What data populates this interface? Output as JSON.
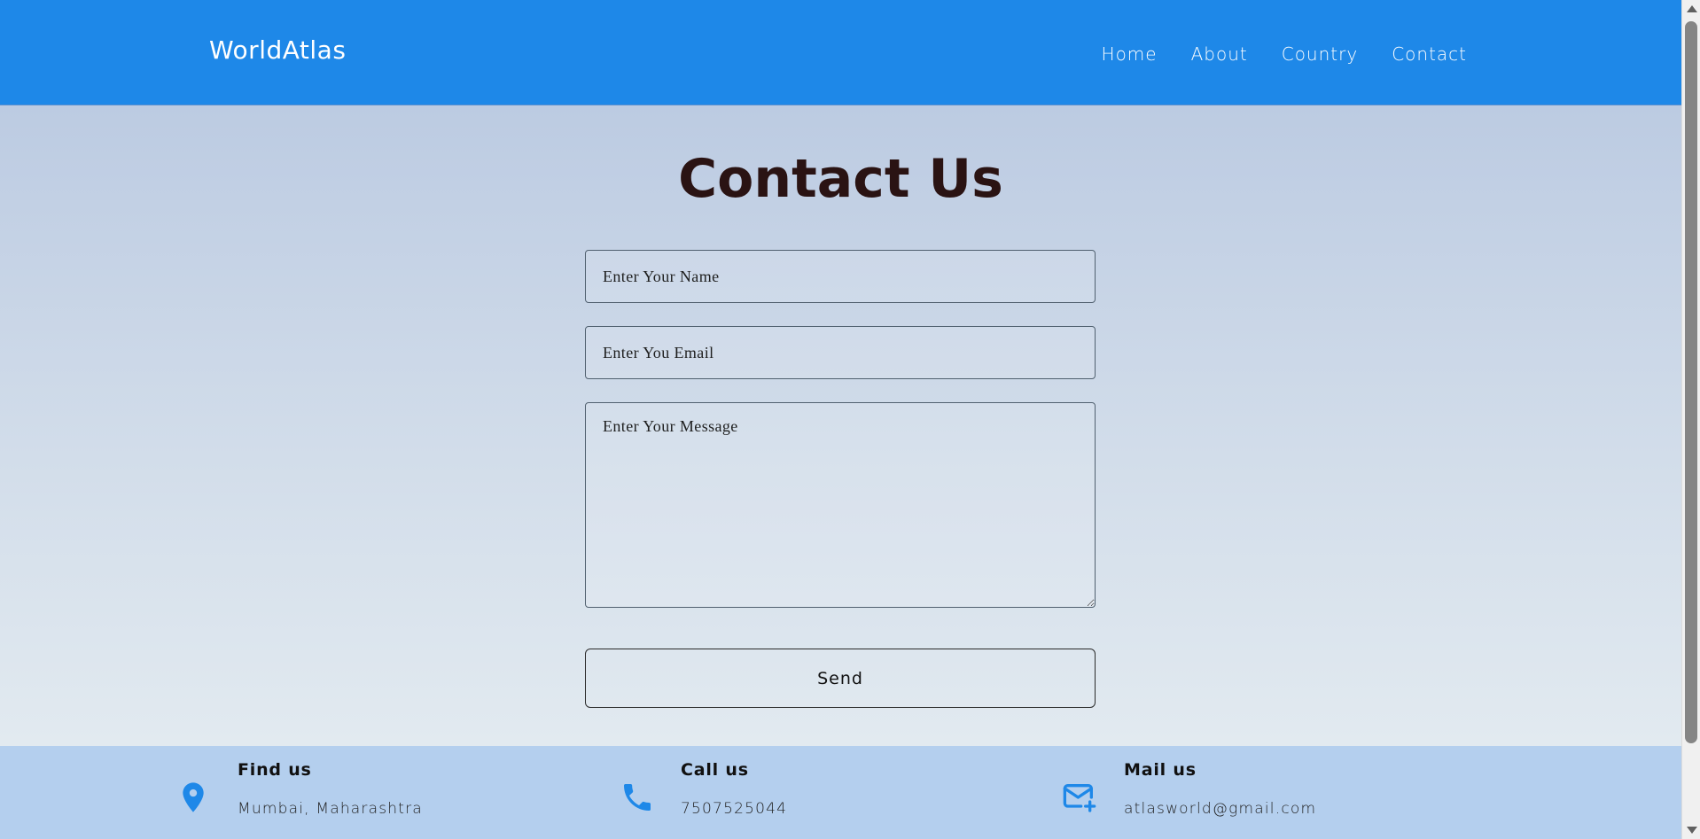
{
  "header": {
    "logo": "WorldAtlas",
    "nav": [
      {
        "label": "Home"
      },
      {
        "label": "About"
      },
      {
        "label": "Country"
      },
      {
        "label": "Contact"
      }
    ]
  },
  "main": {
    "title": "Contact Us",
    "form": {
      "name_placeholder": "Enter Your Name",
      "name_value": "",
      "email_placeholder": "Enter You Email",
      "email_value": "",
      "message_placeholder": "Enter Your Message",
      "message_value": "",
      "send_label": "Send"
    }
  },
  "footer": {
    "items": [
      {
        "label": "Find us",
        "value": "Mumbai, Maharashtra",
        "icon": "map-pin-icon"
      },
      {
        "label": "Call us",
        "value": "7507525044",
        "icon": "phone-icon"
      },
      {
        "label": "Mail us",
        "value": "atlasworld@gmail.com",
        "icon": "mail-plus-icon"
      }
    ]
  },
  "colors": {
    "header_bg": "#1e88e8",
    "footer_bg": "#b4cfee",
    "icon_accent": "#1e88e8",
    "title_text": "#2a1313"
  }
}
